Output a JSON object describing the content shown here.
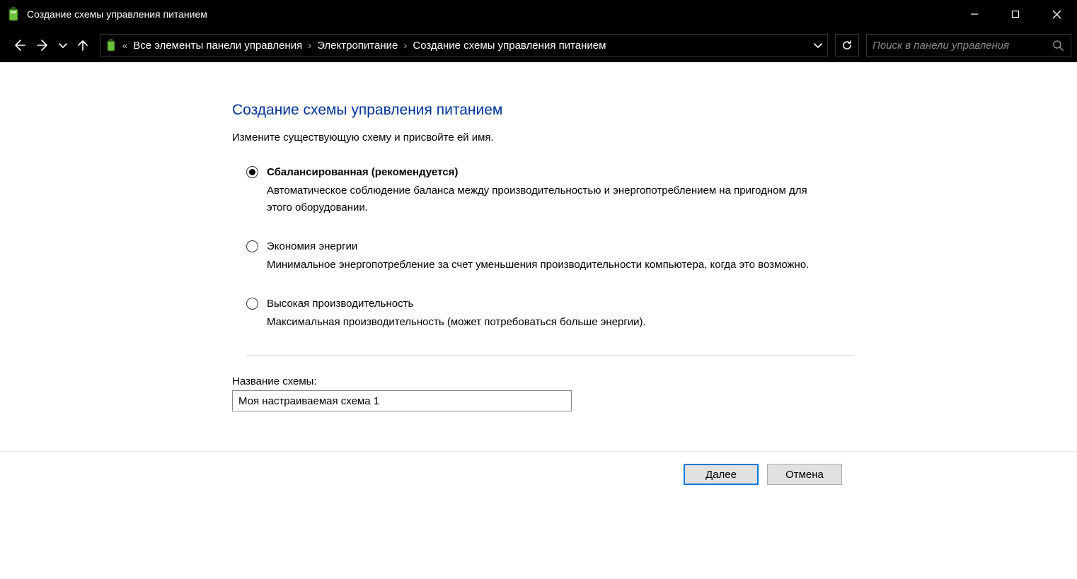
{
  "window": {
    "title": "Создание схемы управления питанием"
  },
  "breadcrumbs": {
    "item0": "Все элементы панели управления",
    "item1": "Электропитание",
    "item2": "Создание схемы управления питанием"
  },
  "search": {
    "placeholder": "Поиск в панели управления"
  },
  "page": {
    "title": "Создание схемы управления питанием",
    "instruction": "Измените существующую схему и присвойте ей имя."
  },
  "plans": [
    {
      "label": "Сбалансированная (рекомендуется)",
      "desc": "Автоматическое соблюдение баланса между производительностью и энергопотреблением на пригодном для этого оборудовании.",
      "checked": true
    },
    {
      "label": "Экономия энергии",
      "desc": "Минимальное энергопотребление за счет уменьшения производительности компьютера, когда это возможно.",
      "checked": false
    },
    {
      "label": "Высокая производительность",
      "desc": "Максимальная производительность (может потребоваться больше энергии).",
      "checked": false
    }
  ],
  "name_field": {
    "label": "Название схемы:",
    "value": "Моя настраиваемая схема 1"
  },
  "buttons": {
    "next": "Далее",
    "cancel": "Отмена"
  }
}
